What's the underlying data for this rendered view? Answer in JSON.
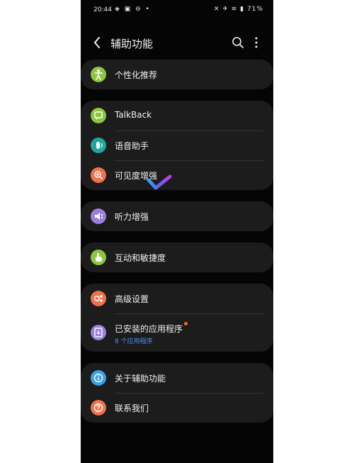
{
  "status": {
    "time": "20:44",
    "left_icons": "◈ ▣ ⊖ •",
    "battery": "71%",
    "right_icons": "✕ ✈ ≋ ▮"
  },
  "header": {
    "title": "辅助功能"
  },
  "items": {
    "personalize": "个性化推荐",
    "talkback": "TalkBack",
    "voice_assist": "语音助手",
    "visibility": "可见度增强",
    "hearing": "听力增强",
    "interaction": "互动和敏捷度",
    "advanced": "高级设置",
    "installed": "已安装的应用程序",
    "installed_sub": "8 个应用程序",
    "about": "关于辅助功能",
    "contact": "联系我们"
  },
  "colors": {
    "green": "#8dc63f",
    "teal": "#1ea89b",
    "orange": "#f0714a",
    "purple": "#9b7fe0",
    "blue": "#3aa0e8",
    "accent_blue": "#4a8ef5",
    "badge": "#f26b21"
  },
  "icons": {
    "personalize": "accessibility-person-icon",
    "talkback": "chat-bubble-icon",
    "voice_assist": "voice-waves-icon",
    "visibility": "magnifier-icon",
    "hearing": "speaker-icon",
    "interaction": "hand-touch-icon",
    "advanced": "gears-icon",
    "installed": "app-download-icon",
    "about": "info-icon",
    "contact": "question-icon"
  }
}
